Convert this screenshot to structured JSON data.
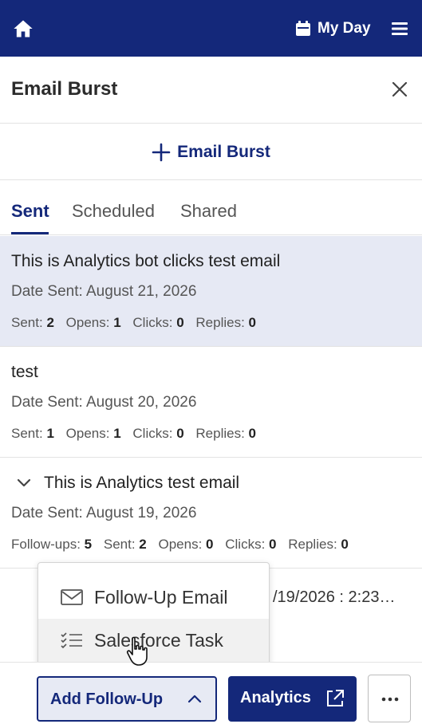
{
  "topbar": {
    "my_day_label": "My Day",
    "icons": [
      "home-icon",
      "calendar-icon",
      "hamburger-menu-icon"
    ]
  },
  "panel": {
    "title": "Email Burst"
  },
  "add_burst": {
    "label": "Email Burst"
  },
  "tabs": [
    {
      "label": "Sent",
      "active": true
    },
    {
      "label": "Scheduled",
      "active": false
    },
    {
      "label": "Shared",
      "active": false
    }
  ],
  "emails": [
    {
      "title": "This is Analytics bot clicks test email",
      "date_label": "Date Sent: August 21, 2026",
      "stats": [
        {
          "label": "Sent:",
          "value": "2"
        },
        {
          "label": "Opens:",
          "value": "1"
        },
        {
          "label": "Clicks:",
          "value": "0"
        },
        {
          "label": "Replies:",
          "value": "0"
        }
      ],
      "selected": true
    },
    {
      "title": "test",
      "date_label": "Date Sent: August 20, 2026",
      "stats": [
        {
          "label": "Sent:",
          "value": "1"
        },
        {
          "label": "Opens:",
          "value": "1"
        },
        {
          "label": "Clicks:",
          "value": "0"
        },
        {
          "label": "Replies:",
          "value": "0"
        }
      ],
      "selected": false
    },
    {
      "title": "This is Analytics test email",
      "date_label": "Date Sent: August 19, 2026",
      "stats": [
        {
          "label": "Follow-ups:",
          "value": "5"
        },
        {
          "label": "Sent:",
          "value": "2"
        },
        {
          "label": "Opens:",
          "value": "0"
        },
        {
          "label": "Clicks:",
          "value": "0"
        },
        {
          "label": "Replies:",
          "value": "0"
        }
      ],
      "expandable": true
    }
  ],
  "partial_row": {
    "timestamp": "/19/2026 : 2:23…"
  },
  "dropdown": {
    "items": [
      {
        "label": "Follow-Up Email",
        "icon": "envelope-icon"
      },
      {
        "label": "Salesforce Task",
        "icon": "checklist-icon",
        "hovered": true
      }
    ]
  },
  "footer": {
    "add_follow_up_label": "Add Follow-Up",
    "analytics_label": "Analytics",
    "more_label": "..."
  },
  "colors": {
    "brand": "#14287a",
    "selected_row": "#e6e9f4",
    "divider": "#e3e3e3"
  }
}
